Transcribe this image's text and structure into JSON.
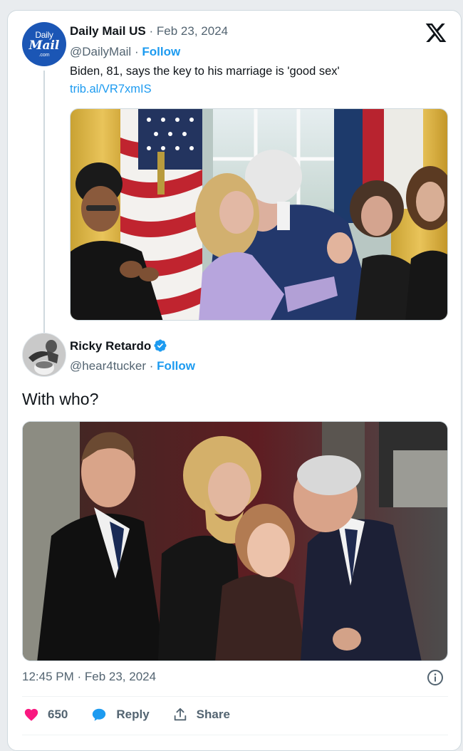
{
  "quoted_tweet": {
    "avatar_lines": [
      "Daily",
      "Mail",
      ".com"
    ],
    "author_name": "Daily Mail US",
    "date": "Feb 23, 2024",
    "handle": "@DailyMail",
    "follow_label": "Follow",
    "text": "Biden, 81, says the key to his marriage is 'good sex'",
    "link": "trib.al/VR7xmIS",
    "image_alt": "photo"
  },
  "main_tweet": {
    "author_name": "Ricky Retardo",
    "handle": "@hear4tucker",
    "follow_label": "Follow",
    "text": "With who?",
    "timestamp": "12:45 PM · Feb 23, 2024"
  },
  "actions": {
    "likes_count": "650",
    "reply_label": "Reply",
    "share_label": "Share"
  },
  "separator": "·",
  "colors": {
    "accent": "#1d9bf0",
    "like": "#f91880",
    "muted": "#536471"
  },
  "icons": [
    "x-logo-icon",
    "verified-badge-icon",
    "info-icon",
    "heart-icon",
    "reply-icon",
    "share-icon"
  ]
}
